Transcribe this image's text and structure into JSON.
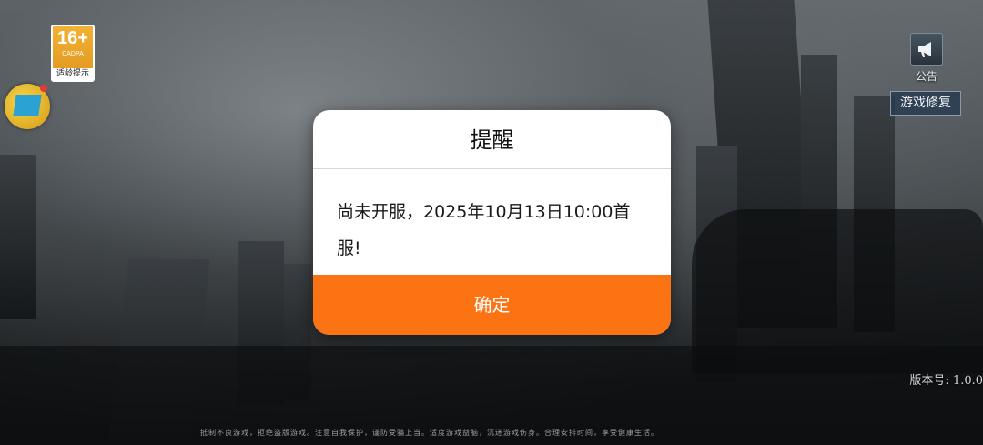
{
  "age_rating": {
    "number": "16+",
    "org": "CADPA",
    "tip": "适龄提示",
    "color": "#f2b233"
  },
  "float_logo": {
    "icon": "game-logo-icon",
    "badge_color": "#e53935"
  },
  "notice": {
    "label": "公告",
    "icon": "megaphone-icon"
  },
  "repair_button": {
    "label": "游戏修复"
  },
  "version": {
    "label": "版本号: 1.0.0"
  },
  "health_notice": "抵制不良游戏，拒绝盗版游戏。注意自我保护，谨防受骗上当。适度游戏益脑，沉迷游戏伤身。合理安排时间，享受健康生活。",
  "dialog": {
    "title": "提醒",
    "message_line1": "尚未开服，2025年10月13日10:00首",
    "message_line2": "服!",
    "confirm_label": "确定",
    "accent_color": "#fb7312"
  }
}
